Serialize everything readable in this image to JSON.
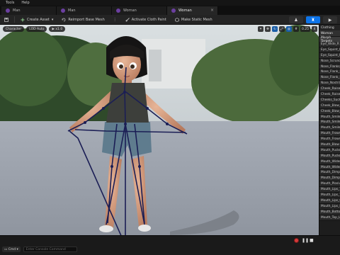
{
  "menu": {
    "items": [
      "Tools",
      "Help"
    ]
  },
  "tabs": [
    {
      "label": "Man",
      "active": false
    },
    {
      "label": "Man",
      "active": false
    },
    {
      "label": "Woman",
      "active": false
    },
    {
      "label": "Woman",
      "active": true
    }
  ],
  "toolbar": {
    "create_asset": "Create Asset",
    "reimport": "Reimport Base Mesh",
    "activate_cloth": "Activate Cloth Paint",
    "make_static": "Make Static Mesh"
  },
  "viewport": {
    "character_btn": "Character",
    "lod_btn": "LOD Auto",
    "speed_btn": "x1.0",
    "right_tools": [
      "0.25",
      "4"
    ]
  },
  "panel": {
    "title": "Clothing",
    "header": "Woman",
    "section": "Morph Targets",
    "morphs": [
      "Eye_Wide_R",
      "Eye_Squint_L",
      "Eye_Squint_R",
      "Nose_Scrunch",
      "Nose_Flanks_Up",
      "Nose_Flank_Raise",
      "Nose_Flank_Lower",
      "Nose_Nostril_Flare",
      "Cheek_Raise_L",
      "Cheek_Raise_R",
      "Cheeks_Suck",
      "Cheek_Blow_L",
      "Cheek_Blow_R",
      "Mouth_Smile_L",
      "Mouth_Smile_R",
      "Mouth_Smile_Sharp",
      "Mouth_Frown_L",
      "Mouth_Frown_R",
      "Mouth_Blow",
      "Mouth_Pucker",
      "Mouth_Pucker_Open",
      "Mouth_Widen",
      "Mouth_Widen_Sides",
      "Mouth_Dimple_L",
      "Mouth_Dimple_R",
      "Mouth_Plosive",
      "Mouth_Lips_Tight",
      "Mouth_Lips_Tuck",
      "Mouth_Lips_Open",
      "Mouth_Lips_Part",
      "Mouth_Bottom_Lip",
      "Mouth_Top_Lip_Up"
    ]
  },
  "bottom": {
    "cmd_label": "Cmd",
    "cmd_placeholder": "Enter Console Command"
  },
  "colors": {
    "accent": "#0e74e8",
    "tab_dot": "#6b3fa0",
    "bone": "#1b1e55",
    "record": "#d63a3a"
  }
}
